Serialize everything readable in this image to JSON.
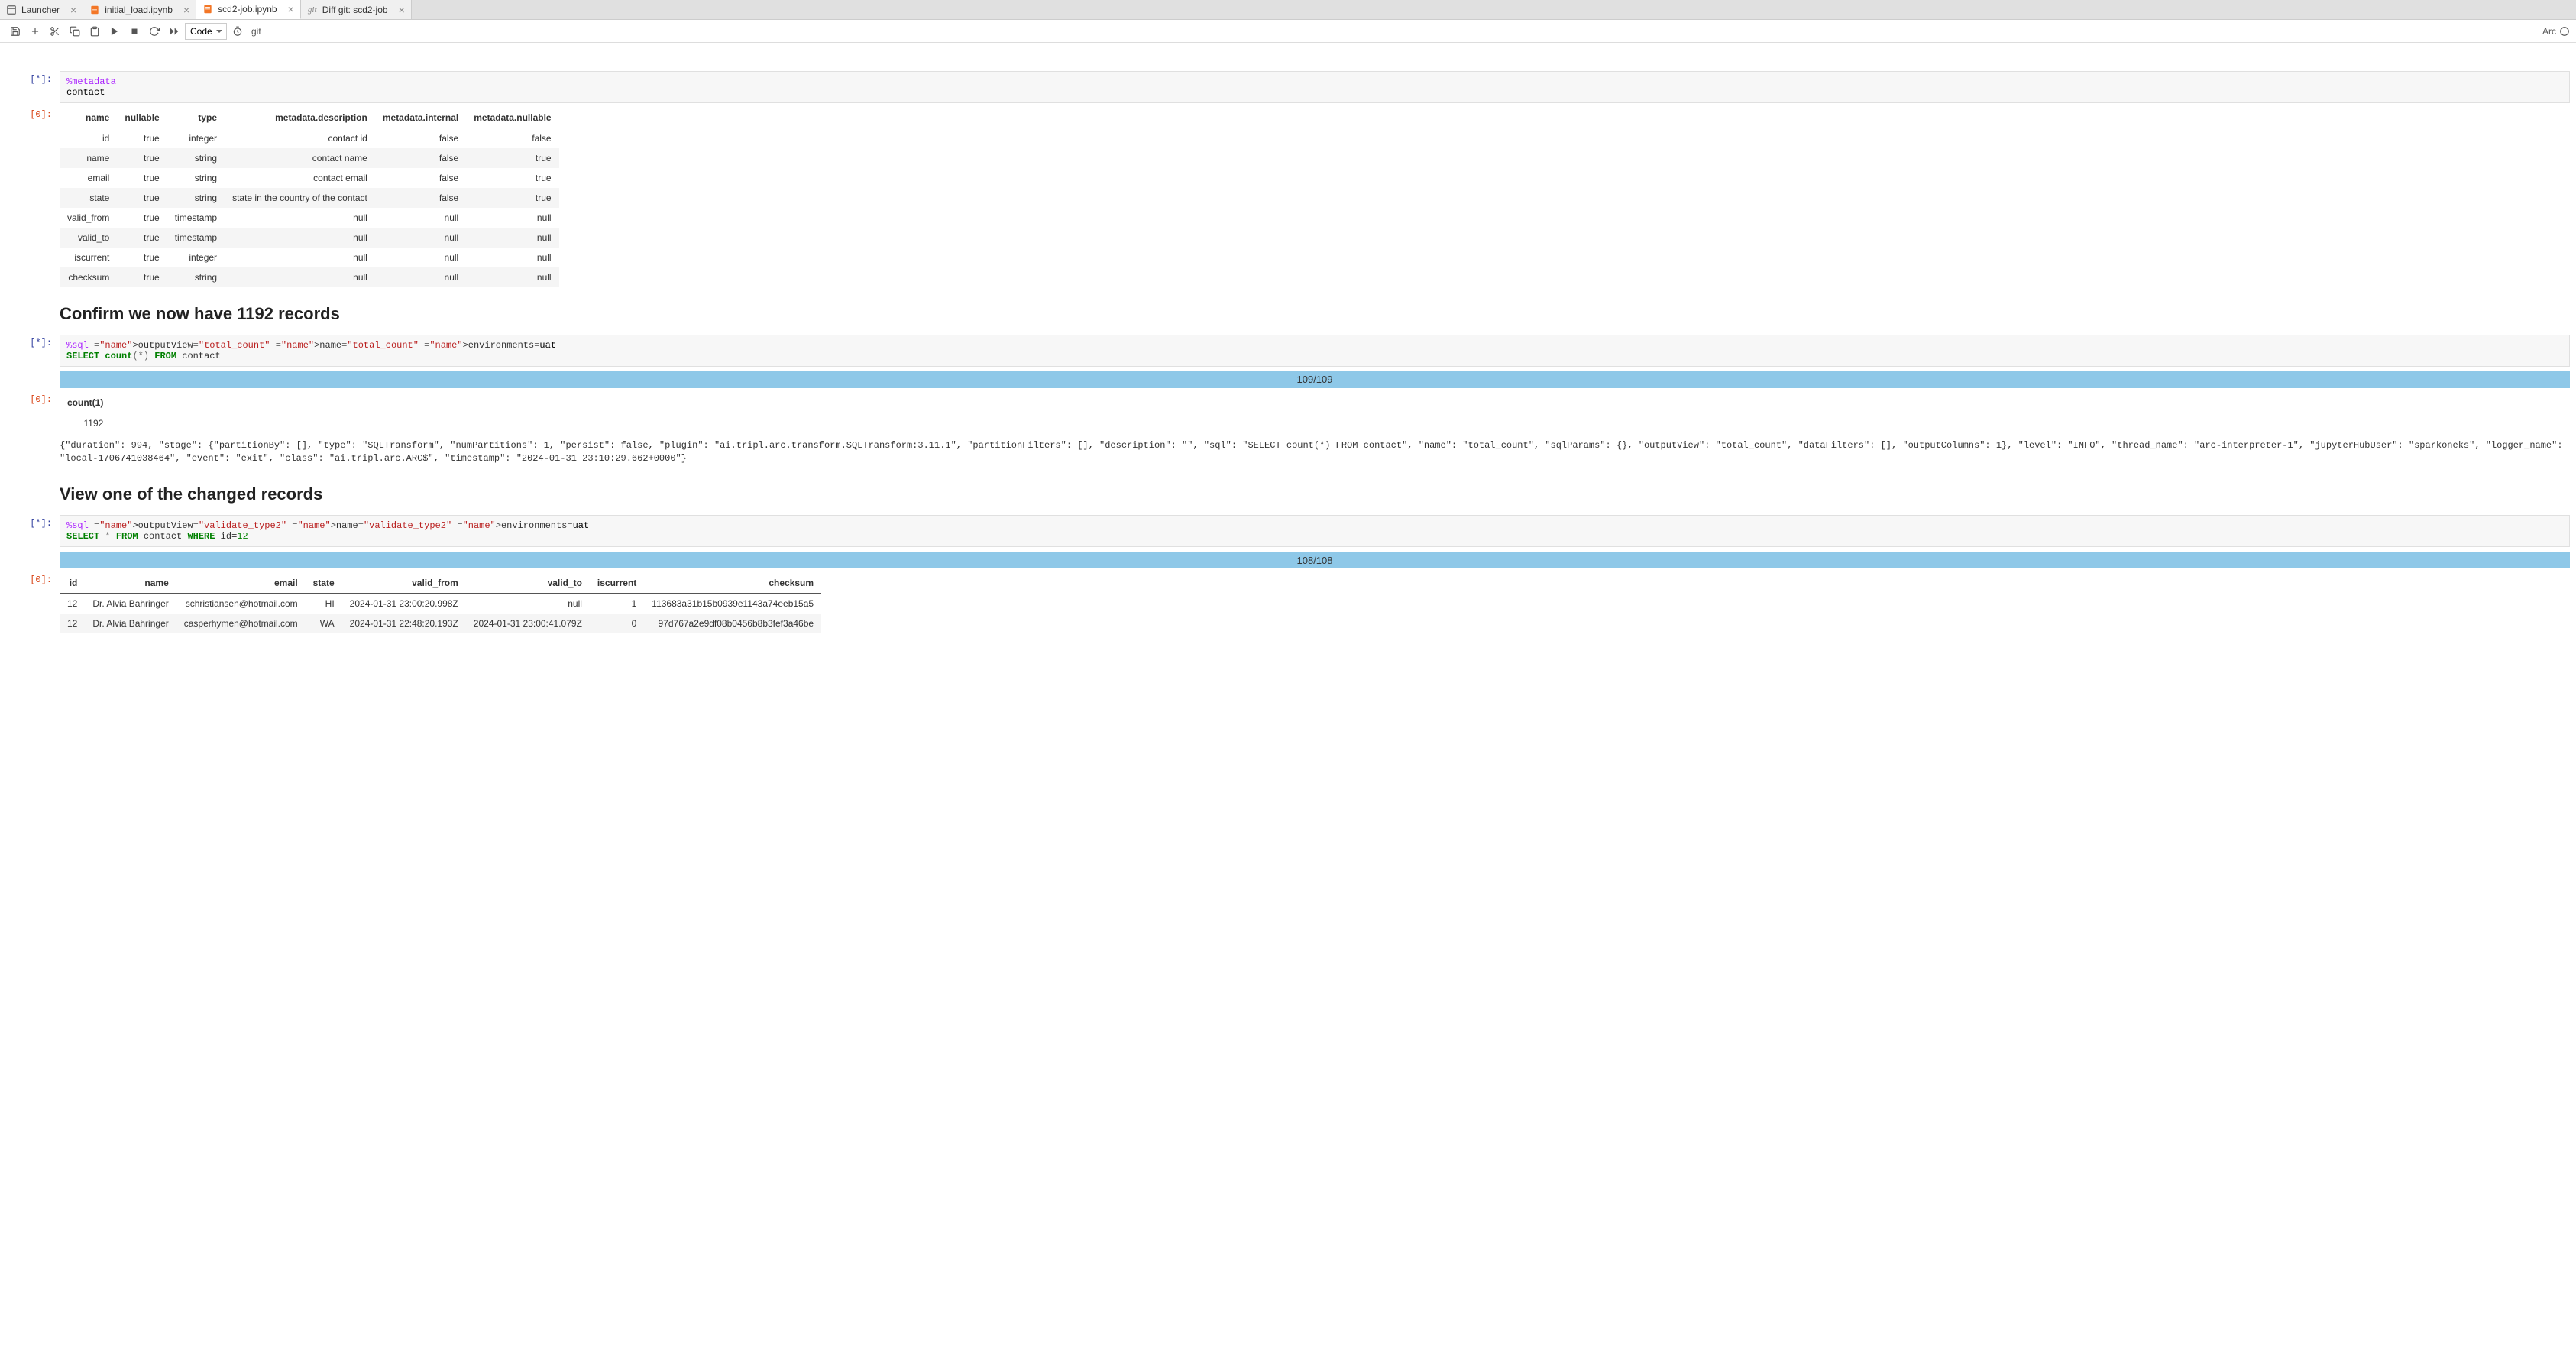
{
  "tabs": [
    {
      "label": "Launcher",
      "icon": "launcher",
      "active": false
    },
    {
      "label": "initial_load.ipynb",
      "icon": "notebook",
      "active": false
    },
    {
      "label": "scd2-job.ipynb",
      "icon": "notebook",
      "active": true
    },
    {
      "label": "Diff git: scd2-job",
      "icon": "git",
      "active": false
    }
  ],
  "toolbar": {
    "cell_type": "Code",
    "git_label": "git",
    "kernel": "Arc"
  },
  "cells": {
    "metadata_cell": {
      "prompt": "[*]:",
      "code_line1": "%metadata",
      "code_line2": "contact"
    },
    "metadata_out": {
      "prompt": "[0]:",
      "headers": [
        "name",
        "nullable",
        "type",
        "metadata.description",
        "metadata.internal",
        "metadata.nullable"
      ],
      "rows": [
        [
          "id",
          "true",
          "integer",
          "contact id",
          "false",
          "false"
        ],
        [
          "name",
          "true",
          "string",
          "contact name",
          "false",
          "true"
        ],
        [
          "email",
          "true",
          "string",
          "contact email",
          "false",
          "true"
        ],
        [
          "state",
          "true",
          "string",
          "state in the country of the contact",
          "false",
          "true"
        ],
        [
          "valid_from",
          "true",
          "timestamp",
          "null",
          "null",
          "null"
        ],
        [
          "valid_to",
          "true",
          "timestamp",
          "null",
          "null",
          "null"
        ],
        [
          "iscurrent",
          "true",
          "integer",
          "null",
          "null",
          "null"
        ],
        [
          "checksum",
          "true",
          "string",
          "null",
          "null",
          "null"
        ]
      ]
    },
    "heading1": "Confirm we now have 1192 records",
    "sql1": {
      "prompt": "[*]:",
      "magic": "%sql",
      "args": " outputView=\"total_count\" name=\"total_count\" environments=uat",
      "line2_kw1": "SELECT",
      "line2_func": "count",
      "line2_paren": "(*)",
      "line2_kw2": "FROM",
      "line2_tbl": " contact"
    },
    "progress1": "109/109",
    "count_out": {
      "prompt": "[0]:",
      "header": "count(1)",
      "value": "1192"
    },
    "raw_json": "{\"duration\": 994, \"stage\": {\"partitionBy\": [], \"type\": \"SQLTransform\", \"numPartitions\": 1, \"persist\": false, \"plugin\": \"ai.tripl.arc.transform.SQLTransform:3.11.1\", \"partitionFilters\": [], \"description\": \"\", \"sql\": \"SELECT count(*) FROM contact\", \"name\": \"total_count\", \"sqlParams\": {}, \"outputView\": \"total_count\", \"dataFilters\": [], \"outputColumns\": 1}, \"level\": \"INFO\", \"thread_name\": \"arc-interpreter-1\", \"jupyterHubUser\": \"sparkoneks\", \"logger_name\": \"local-1706741038464\", \"event\": \"exit\", \"class\": \"ai.tripl.arc.ARC$\", \"timestamp\": \"2024-01-31 23:10:29.662+0000\"}",
    "heading2": "View one of the changed records",
    "sql2": {
      "prompt": "[*]:",
      "magic": "%sql",
      "args": " outputView=\"validate_type2\" name=\"validate_type2\" environments=uat",
      "line2_kw1": "SELECT",
      "line2_star": " * ",
      "line2_kw2": "FROM",
      "line2_tbl": " contact ",
      "line2_kw3": "WHERE",
      "line2_cond": " id=",
      "line2_num": "12"
    },
    "progress2": "108/108",
    "records_out": {
      "prompt": "[0]:",
      "headers": [
        "id",
        "name",
        "email",
        "state",
        "valid_from",
        "valid_to",
        "iscurrent",
        "checksum"
      ],
      "rows": [
        [
          "12",
          "Dr. Alvia Bahringer",
          "schristiansen@hotmail.com",
          "HI",
          "2024-01-31 23:00:20.998Z",
          "null",
          "1",
          "113683a31b15b0939e1143a74eeb15a5"
        ],
        [
          "12",
          "Dr. Alvia Bahringer",
          "casperhymen@hotmail.com",
          "WA",
          "2024-01-31 22:48:20.193Z",
          "2024-01-31 23:00:41.079Z",
          "0",
          "97d767a2e9df08b0456b8b3fef3a46be"
        ]
      ]
    }
  }
}
